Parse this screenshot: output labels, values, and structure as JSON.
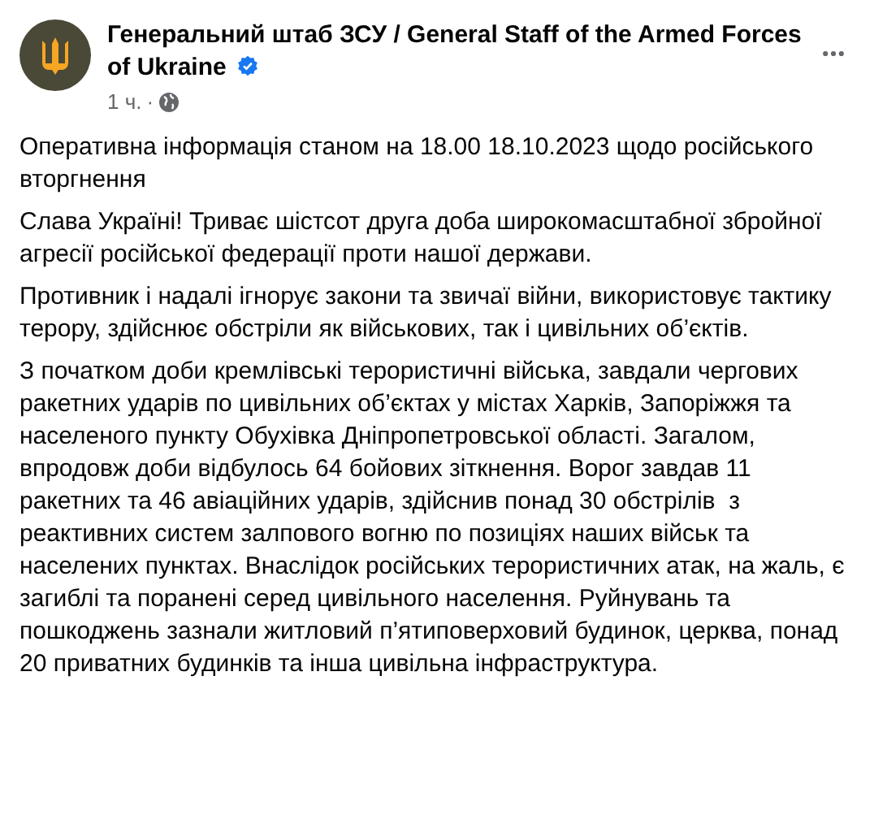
{
  "post": {
    "author": "Генеральний штаб ЗСУ / General Staff of the Armed Forces of Ukraine",
    "verified": true,
    "time": "1 ч.",
    "separator": "·",
    "paragraphs": [
      "Оперативна інформація станом на 18.00 18.10.2023 щодо російського вторгнення",
      "Слава Україні! Триває шістсот друга доба широкомасштабної збройної агресії російської федерації проти нашої держави.",
      "Противник і надалі ігнорує закони та звичаї війни, використовує тактику терору, здійснює обстріли як військових, так і цивільних об’єктів.",
      "З початком доби кремлівські терористичні війська, завдали чергових ракетних ударів по цивільних об’єктах у містах Харків, Запоріжжя та населеного пункту Обухівка Дніпропетровської області. Загалом, впродовж доби відбулось 64 бойових зіткнення. Ворог завдав 11 ракетних та 46 авіаційних ударів, здійснив понад 30 обстрілів  з реактивних систем залпового вогню по позиціях наших військ та населених пунктах. Внаслідок російських терористичних атак, на жаль, є загиблі та поранені серед цивільного населення. Руйнувань та пошкоджень зазнали житловий п’ятиповерховий будинок, церква, понад 20 приватних будинків та інша цивільна інфраструктура."
    ]
  }
}
